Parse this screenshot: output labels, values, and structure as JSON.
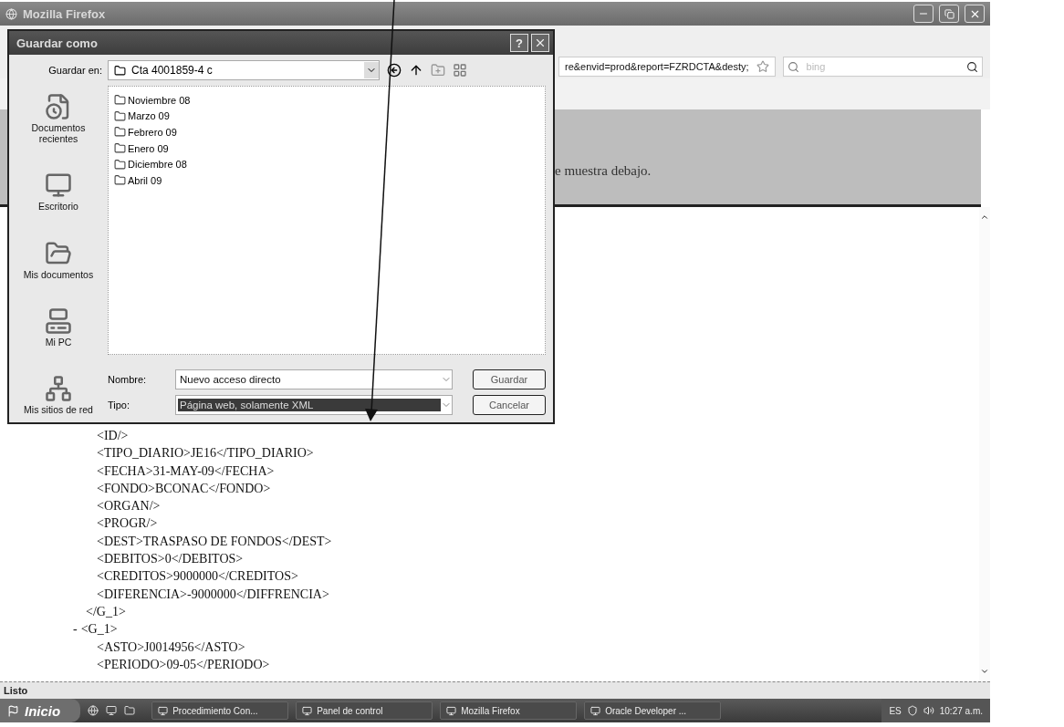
{
  "browser": {
    "title": "Mozilla Firefox",
    "address": "re&envid=prod&report=FZRDCTA&desty;",
    "search": {
      "placeholder": "bing"
    },
    "notice": "e muestra debajo.",
    "xml": [
      {
        "children": [
          {
            "text": "<ID/>"
          },
          {
            "text": "<TIPO_DIARIO>JE16</TIPO_DIARIO>"
          },
          {
            "text": "<FECHA>31-MAY-09</FECHA>"
          },
          {
            "text": "<FONDO>BCONAC</FONDO>"
          },
          {
            "text": "<ORGAN/>"
          },
          {
            "text": "<PROGR/>"
          },
          {
            "text": "<DEST>TRASPASO DE FONDOS</DEST>"
          },
          {
            "text": "<DEBITOS>0</DEBITOS>"
          },
          {
            "text": "<CREDITOS>9000000</CREDITOS>"
          },
          {
            "text": "<DIFERENCIA>-9000000</DIFFRENCIA>"
          }
        ],
        "closing": "</G_1>"
      },
      {
        "toggle": "-",
        "text": "<G_1>",
        "children": [
          {
            "text": "<ASTO>J0014956</ASTO>"
          },
          {
            "text": "<PERIODO>09-05</PERIODO>"
          }
        ]
      }
    ],
    "status": "Listo"
  },
  "dialog": {
    "title": "Guardar como",
    "help": "?",
    "save_in_label": "Guardar en:",
    "save_in": "Cta 4001859-4 c",
    "places": [
      {
        "kind": "recent",
        "label": "Documentos recientes"
      },
      {
        "kind": "desktop",
        "label": "Escritorio"
      },
      {
        "kind": "documents",
        "label": "Mis documentos"
      },
      {
        "kind": "computer",
        "label": "Mi PC"
      },
      {
        "kind": "network",
        "label": "Mis sitios de red"
      }
    ],
    "files": [
      "Noviembre 08",
      "Marzo 09",
      "Febrero 09",
      "Enero 09",
      "Diciembre 08",
      "Abril 09"
    ],
    "name_label": "Nombre:",
    "name": "Nuevo acceso directo",
    "type_label": "Tipo:",
    "type": "Página web, solamente XML",
    "type_highlighted": true,
    "buttons": [
      "Guardar",
      "Cancelar"
    ]
  },
  "taskbar": {
    "start": "Inicio",
    "tasks": [
      {
        "label": "Procedimiento Con..."
      },
      {
        "label": "Panel de control"
      },
      {
        "label": "Mozilla Firefox"
      },
      {
        "label": "Oracle Developer ..."
      }
    ],
    "language": "ES",
    "clock": "10:27 a.m."
  }
}
